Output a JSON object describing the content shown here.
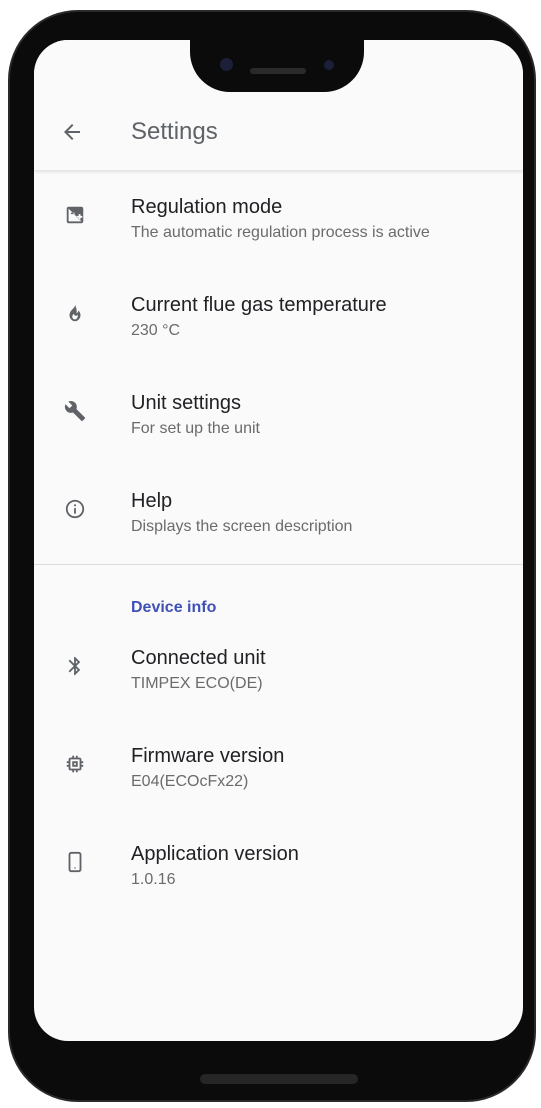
{
  "app_bar": {
    "title": "Settings"
  },
  "settings_items": [
    {
      "title": "Regulation mode",
      "subtitle": "The automatic regulation process is active",
      "icon": "auto-mode-icon"
    },
    {
      "title": "Current flue gas temperature",
      "subtitle": "230 °C",
      "icon": "flame-icon"
    },
    {
      "title": "Unit settings",
      "subtitle": "For set up the unit",
      "icon": "wrench-icon"
    },
    {
      "title": "Help",
      "subtitle": "Displays the screen description",
      "icon": "info-icon"
    }
  ],
  "device_info": {
    "header": "Device info",
    "items": [
      {
        "title": "Connected unit",
        "subtitle": "TIMPEX ECO(DE)",
        "icon": "bluetooth-icon"
      },
      {
        "title": "Firmware version",
        "subtitle": "E04(ECOcFx22)",
        "icon": "chip-icon"
      },
      {
        "title": "Application version",
        "subtitle": "1.0.16",
        "icon": "phone-icon"
      }
    ]
  },
  "colors": {
    "accent": "#3f51b5",
    "icon": "#5f6368",
    "background": "#fafafa"
  }
}
